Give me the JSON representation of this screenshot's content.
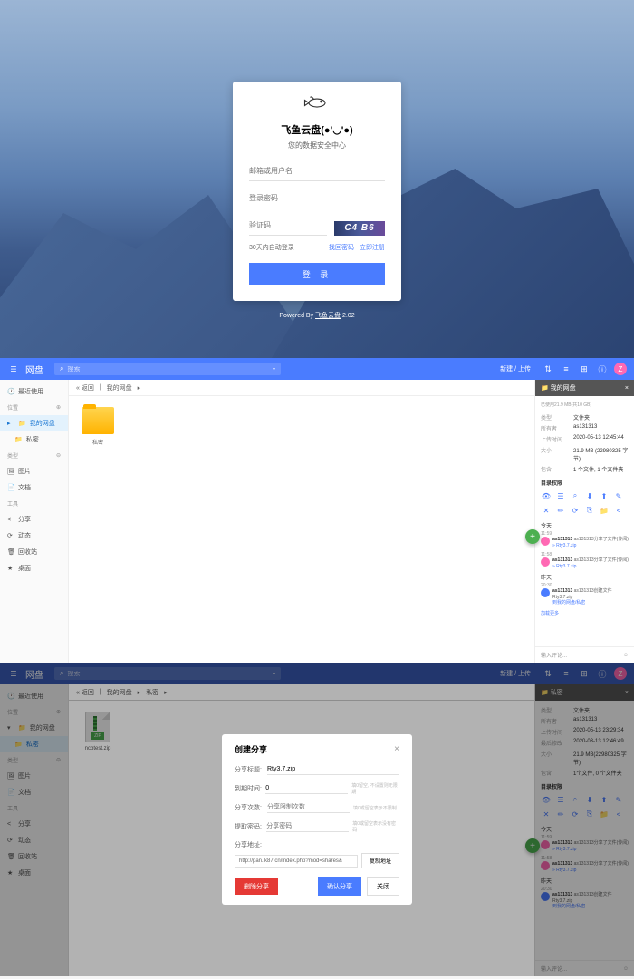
{
  "login": {
    "title": "飞鱼云盘(●'◡'●)",
    "subtitle": "您的数据安全中心",
    "email_placeholder": "邮箱或用户名",
    "password_placeholder": "登录密码",
    "captcha_placeholder": "验证码",
    "captcha_text": "C4 B6",
    "auto_login": "30天内自动登录",
    "forgot": "找回密码",
    "register": "立即注册",
    "login_btn": "登 录",
    "powered_prefix": "Powered By ",
    "powered_link": "飞鱼云盘",
    "powered_version": " 2.02"
  },
  "fm": {
    "title": "网盘",
    "search_placeholder": "搜索",
    "upload": "新建 / 上传",
    "sidebar": {
      "recent": "最近使用",
      "location": "位置",
      "my_disk": "我的网盘",
      "private": "私密",
      "type": "类型",
      "image": "图片",
      "document": "文档",
      "tools": "工具",
      "share": "分享",
      "activity": "动态",
      "recycle": "回收站",
      "desktop": "桌面"
    },
    "breadcrumb": {
      "back": "« 返回",
      "my_disk": "我的网盘"
    },
    "folder_name": "私密",
    "detail": {
      "title": "我的网盘",
      "usage": "已使用21.9 MB(共10 GB)",
      "type_label": "类型",
      "type_value": "文件夹",
      "owner_label": "所有者",
      "owner_value": "as131313",
      "upload_label": "上传时间",
      "upload_value": "2020-05-13 12:45:44",
      "size_label": "大小",
      "size_value": "21.9 MB (22980325 字节)",
      "contains_label": "包含",
      "contains_value": "1 个文件, 1 个文件夹",
      "perm_section": "目录权限",
      "today": "今天",
      "yesterday": "昨天",
      "log1_time": "11:59",
      "log1_user": "as131313",
      "log1_text": " as131313分享了文件(传阅)",
      "log1_file": "» Rty3.7.zip",
      "log2_time": "11:58",
      "log2_user": "as131313",
      "log2_text": " as131313分享了文件(传阅)",
      "log2_file": "» Rty3.7.zip",
      "log3_time": "20:30",
      "log3_user": "as131313",
      "log3_text": " as131313创建文件Rty3.7.zip",
      "log3_link": "到我的网盘/私密",
      "more": "加载更多",
      "comment_placeholder": "输入评论..."
    }
  },
  "fm2": {
    "breadcrumb_private": "私密",
    "zip_name": "ncbtest.zip",
    "detail": {
      "title": "私密",
      "type_value": "文件夹",
      "owner_value": "as131313",
      "created_label": "上传时间",
      "created_value": "2020-05-13 23:29:34",
      "modified_label": "最后修改",
      "modified_value": "2020-03-13 12:46:49",
      "size_value": "21.9 MB(22980325 字节)",
      "contains_value": "1个文件, 0 个文件夹"
    }
  },
  "modal": {
    "title": "创建分享",
    "share_title_label": "分享标题:",
    "share_title_value": "Rty3.7.zip",
    "expire_label": "到期时间:",
    "expire_value": "0",
    "expire_hint": "填0留空, 不设置则无限期",
    "times_label": "分享次数:",
    "times_placeholder": "分享限制次数",
    "times_hint": "填0或留空表示不限制",
    "password_label": "提取密码:",
    "password_placeholder": "分享密码",
    "password_hint": "填0或留空表示没有密码",
    "link_label": "分享地址:",
    "link_value": "http://pan.lk87.cn/index.php?mod=shares&",
    "copy_btn": "复制地址",
    "delete_btn": "删除分享",
    "share_btn": "确认分享",
    "close_btn": "关闭"
  }
}
